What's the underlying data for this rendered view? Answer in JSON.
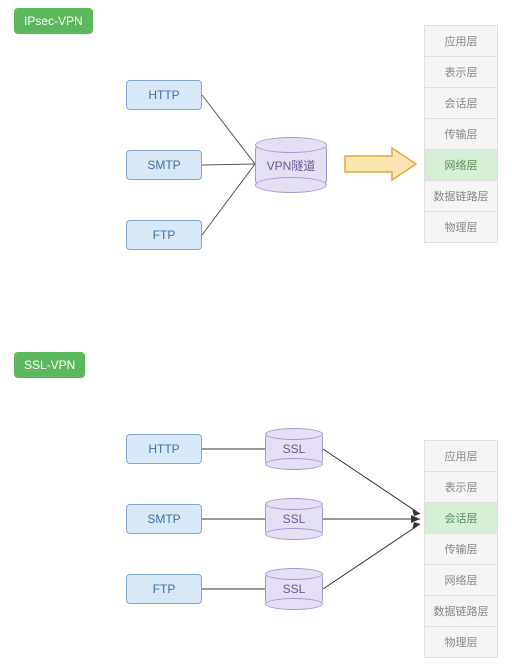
{
  "badges": {
    "ipsec": "IPsec-VPN",
    "ssl": "SSL-VPN"
  },
  "protocols": [
    "HTTP",
    "SMTP",
    "FTP"
  ],
  "tunnel_label": "VPN隧道",
  "ssl_label": "SSL",
  "osi_layers": [
    "应用层",
    "表示层",
    "会话层",
    "传输层",
    "网络层",
    "数据链路层",
    "物理层"
  ],
  "ipsec_highlight_layer": 4,
  "ssl_highlight_layer": 2,
  "colors": {
    "badge": "#5cb85c",
    "proto_bg": "#d9e8f7",
    "proto_border": "#7fa8d6",
    "cyl_bg": "#e5dff4",
    "cyl_border": "#a996d4",
    "arrow": "#f2b736",
    "highlight": "#d7efd7"
  }
}
